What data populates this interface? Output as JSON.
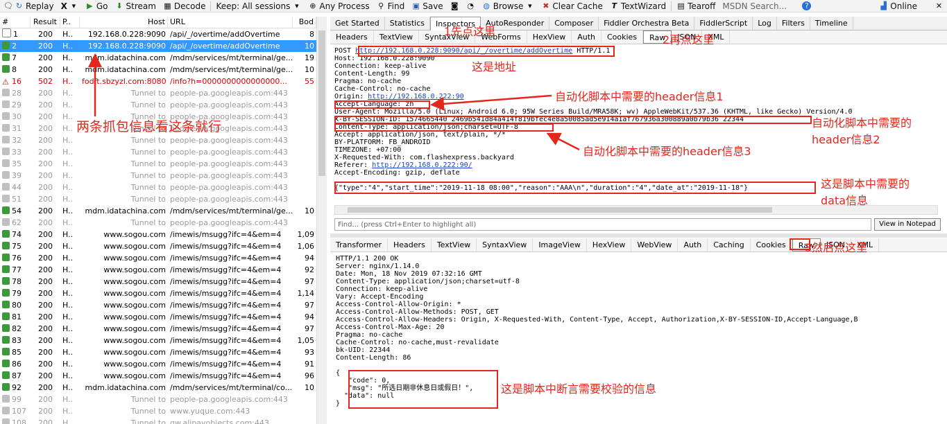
{
  "toolbar": {
    "replay": "Replay",
    "remove": "X",
    "go": "Go",
    "stream": "Stream",
    "decode": "Decode",
    "keep": "Keep: All sessions",
    "any_process": "Any Process",
    "find": "Find",
    "save": "Save",
    "browse": "Browse",
    "clear_cache": "Clear Cache",
    "textwizard": "TextWizard",
    "tearoff": "Tearoff",
    "msdn": "MSDN Search...",
    "online": "Online"
  },
  "session_headers": {
    "num": "#",
    "result": "Result",
    "proto": "P..",
    "host": "Host",
    "url": "URL",
    "body": "Bod"
  },
  "sessions": [
    {
      "num": "1",
      "result": "200",
      "proto": "H..",
      "host": "192.168.0.228:9090",
      "url": "/api/_/overtime/addOvertime",
      "body": "8",
      "kind": "info"
    },
    {
      "num": "2",
      "result": "200",
      "proto": "H..",
      "host": "192.168.0.228:9090",
      "url": "/api/_/overtime/addOvertime",
      "body": "10",
      "kind": "sel"
    },
    {
      "num": "7",
      "result": "200",
      "proto": "H..",
      "host": "mdm.idatachina.com",
      "url": "/mdm/services/mt/terminal/ge...",
      "body": "19",
      "kind": "ok"
    },
    {
      "num": "8",
      "result": "200",
      "proto": "H..",
      "host": "mdm.idatachina.com",
      "url": "/mdm/services/mt/terminal/ge...",
      "body": "10",
      "kind": "ok"
    },
    {
      "num": "16",
      "result": "502",
      "proto": "H..",
      "host": "fodft.sbzyzl.com:8080",
      "url": "/info?h=0000000000000000...",
      "body": "55",
      "kind": "err"
    },
    {
      "num": "28",
      "result": "200",
      "proto": "H..",
      "host": "Tunnel to",
      "url": "people-pa.googleapis.com:443",
      "body": "",
      "kind": "tun"
    },
    {
      "num": "29",
      "result": "200",
      "proto": "H..",
      "host": "Tunnel to",
      "url": "people-pa.googleapis.com:443",
      "body": "",
      "kind": "tun"
    },
    {
      "num": "30",
      "result": "200",
      "proto": "H..",
      "host": "Tunnel to",
      "url": "people-pa.googleapis.com:443",
      "body": "",
      "kind": "tun"
    },
    {
      "num": "31",
      "result": "200",
      "proto": "H..",
      "host": "Tunnel to",
      "url": "people-pa.googleapis.com:443",
      "body": "",
      "kind": "tun"
    },
    {
      "num": "32",
      "result": "200",
      "proto": "H..",
      "host": "Tunnel to",
      "url": "people-pa.googleapis.com:443",
      "body": "",
      "kind": "tun"
    },
    {
      "num": "33",
      "result": "200",
      "proto": "H..",
      "host": "Tunnel to",
      "url": "people-pa.googleapis.com:443",
      "body": "",
      "kind": "tun"
    },
    {
      "num": "35",
      "result": "200",
      "proto": "H..",
      "host": "Tunnel to",
      "url": "people-pa.googleapis.com:443",
      "body": "",
      "kind": "tun"
    },
    {
      "num": "39",
      "result": "200",
      "proto": "H..",
      "host": "Tunnel to",
      "url": "people-pa.googleapis.com:443",
      "body": "",
      "kind": "tun"
    },
    {
      "num": "44",
      "result": "200",
      "proto": "H..",
      "host": "Tunnel to",
      "url": "people-pa.googleapis.com:443",
      "body": "",
      "kind": "tun"
    },
    {
      "num": "51",
      "result": "200",
      "proto": "H..",
      "host": "Tunnel to",
      "url": "people-pa.googleapis.com:443",
      "body": "",
      "kind": "tun"
    },
    {
      "num": "54",
      "result": "200",
      "proto": "H..",
      "host": "mdm.idatachina.com",
      "url": "/mdm/services/mt/terminal/ge...",
      "body": "10",
      "kind": "ok"
    },
    {
      "num": "62",
      "result": "200",
      "proto": "H..",
      "host": "Tunnel to",
      "url": "people-pa.googleapis.com:443",
      "body": "",
      "kind": "tun"
    },
    {
      "num": "74",
      "result": "200",
      "proto": "H..",
      "host": "www.sogou.com",
      "url": "/imewis/msugg?ifc=4&em=4",
      "body": "1,09",
      "kind": "ok"
    },
    {
      "num": "75",
      "result": "200",
      "proto": "H..",
      "host": "www.sogou.com",
      "url": "/imewis/msugg?ifc=4&em=4",
      "body": "1,06",
      "kind": "ok"
    },
    {
      "num": "76",
      "result": "200",
      "proto": "H..",
      "host": "www.sogou.com",
      "url": "/imewis/msugg?ifc=4&em=4",
      "body": "94",
      "kind": "ok"
    },
    {
      "num": "77",
      "result": "200",
      "proto": "H..",
      "host": "www.sogou.com",
      "url": "/imewis/msugg?ifc=4&em=4",
      "body": "92",
      "kind": "ok"
    },
    {
      "num": "78",
      "result": "200",
      "proto": "H..",
      "host": "www.sogou.com",
      "url": "/imewis/msugg?ifc=4&em=4",
      "body": "97",
      "kind": "ok"
    },
    {
      "num": "79",
      "result": "200",
      "proto": "H..",
      "host": "www.sogou.com",
      "url": "/imewis/msugg?ifc=4&em=4",
      "body": "1,14",
      "kind": "ok"
    },
    {
      "num": "80",
      "result": "200",
      "proto": "H..",
      "host": "www.sogou.com",
      "url": "/imewis/msugg?ifc=4&em=4",
      "body": "97",
      "kind": "ok"
    },
    {
      "num": "81",
      "result": "200",
      "proto": "H..",
      "host": "www.sogou.com",
      "url": "/imewis/msugg?ifc=4&em=4",
      "body": "94",
      "kind": "ok"
    },
    {
      "num": "82",
      "result": "200",
      "proto": "H..",
      "host": "www.sogou.com",
      "url": "/imewis/msugg?ifc=4&em=4",
      "body": "97",
      "kind": "ok"
    },
    {
      "num": "83",
      "result": "200",
      "proto": "H..",
      "host": "www.sogou.com",
      "url": "/imewis/msugg?ifc=4&em=4",
      "body": "1,05",
      "kind": "ok"
    },
    {
      "num": "85",
      "result": "200",
      "proto": "H..",
      "host": "www.sogou.com",
      "url": "/imewis/msugg?ifc=4&em=4",
      "body": "93",
      "kind": "ok"
    },
    {
      "num": "86",
      "result": "200",
      "proto": "H..",
      "host": "www.sogou.com",
      "url": "/imewis/msugg?ifc=4&em=4",
      "body": "91",
      "kind": "ok"
    },
    {
      "num": "87",
      "result": "200",
      "proto": "H..",
      "host": "www.sogou.com",
      "url": "/imewis/msugg?ifc=4&em=4",
      "body": "96",
      "kind": "ok"
    },
    {
      "num": "92",
      "result": "200",
      "proto": "H..",
      "host": "mdm.idatachina.com",
      "url": "/mdm/services/mt/terminal/co...",
      "body": "10",
      "kind": "ok"
    },
    {
      "num": "99",
      "result": "200",
      "proto": "H..",
      "host": "Tunnel to",
      "url": "people-pa.googleapis.com:443",
      "body": "",
      "kind": "tun"
    },
    {
      "num": "107",
      "result": "200",
      "proto": "H..",
      "host": "Tunnel to",
      "url": "www.yuque.com:443",
      "body": "",
      "kind": "tun"
    },
    {
      "num": "108",
      "result": "200",
      "proto": "H..",
      "host": "Tunnel to",
      "url": "gw.alipayobjects.com:443",
      "body": "",
      "kind": "tun"
    }
  ],
  "inspector_tabs": [
    "Get Started",
    "Statistics",
    "Inspectors",
    "AutoResponder",
    "Composer",
    "Fiddler Orchestra Beta",
    "FiddlerScript",
    "Log",
    "Filters",
    "Timeline"
  ],
  "request_tabs": [
    "Headers",
    "TextView",
    "SyntaxView",
    "WebForms",
    "HexView",
    "Auth",
    "Cookies",
    "Raw",
    "JSON",
    "XML"
  ],
  "response_tabs": [
    "Transformer",
    "Headers",
    "TextView",
    "SyntaxView",
    "ImageView",
    "HexView",
    "WebView",
    "Auth",
    "Caching",
    "Cookies",
    "Raw",
    "JSON",
    "XML"
  ],
  "request": {
    "method": "POST ",
    "url": "http://192.168.0.228:9090/api/_/overtime/addOvertime",
    "version": " HTTP/1.1",
    "lines": [
      "Host: 192.168.0.228:9090",
      "Connection: keep-alive",
      "Content-Length: 99",
      "Pragma: no-cache",
      "Cache-Control: no-cache"
    ],
    "origin_label": "Origin: ",
    "origin_url": "http://192.168.0.222:90",
    "lines2": [
      "Accept-Language: zh",
      "User-Agent: Mozilla/5.0 (Linux; Android 6.0; 95W Series Build/MRA58K; wv) AppleWebKit/537.36 (KHTML, like Gecko) Version/4.0",
      "X-BY-SESSION-ID: 1574665440_2469b541d84a414f819bfec4e8a50085ad5e914a1af767936a300889a0b79b36_22344",
      "Content-Type: application/json;charset=UTF-8",
      "Accept: application/json, text/plain, */*",
      "BY-PLATFORM: FB_ANDROID",
      "TIMEZONE: +07:00",
      "X-Requested-With: com.flashexpress.backyard"
    ],
    "referer_label": "Referer: ",
    "referer_url": "http://192.168.0.222:90/",
    "encoding": "Accept-Encoding: gzip, deflate",
    "body": "{\"type\":\"4\",\"start_time\":\"2019-11-18 08:00\",\"reason\":\"AAA\\n\",\"duration\":\"4\",\"date_at\":\"2019-11-18\"}"
  },
  "find_placeholder": "Find... (press Ctrl+Enter to highlight all)",
  "view_notepad": "View in Notepad",
  "response": {
    "lines": [
      "HTTP/1.1 200 OK",
      "Server: nginx/1.14.0",
      "Date: Mon, 18 Nov 2019 07:32:16 GMT",
      "Content-Type: application/json;charset=utf-8",
      "Connection: keep-alive",
      "Vary: Accept-Encoding",
      "Access-Control-Allow-Origin: *",
      "Access-Control-Allow-Methods: POST, GET",
      "Access-Control-Allow-Headers: Origin, X-Requested-With, Content-Type, Accept, Authorization,X-BY-SESSION-ID,Accept-Language,B",
      "Access-Control-Max-Age: 20",
      "Pragma: no-cache",
      "Cache-Control: no-cache,must-revalidate",
      "bk-UID: 22344",
      "Content-Length: 86"
    ],
    "body_lines": [
      "{",
      "   \"code\": 0,",
      "   \"msg\": \"所选日期非休息日或假日！\",",
      "  \"data\": null",
      "}"
    ]
  },
  "annotations": {
    "step1": "1先点这里",
    "step2": "2再点这里",
    "step3": "3然后点这里",
    "address": "这是地址",
    "header1": "自动化脚本中需要的header信息1",
    "header2": "自动化脚本中需要的\nheader信息2",
    "header3": "自动化脚本中需要的header信息3",
    "data_info": "这是脚本中需要的\ndata信息",
    "assert_info": "这是脚本中断言需要校验的信息",
    "two_rows": "两条抓包信息看这条就行"
  },
  "colors": {
    "annotation": "#e3271c",
    "selected_row": "#3399ff",
    "error_row": "#d40000",
    "link": "#1a3ecf"
  }
}
